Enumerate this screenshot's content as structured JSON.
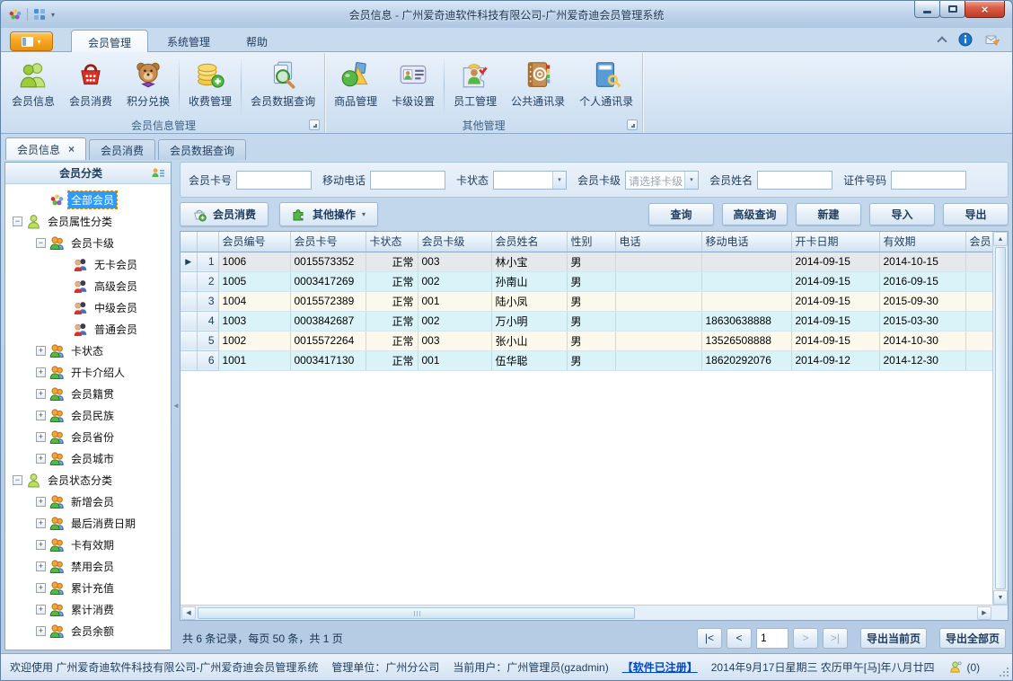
{
  "window": {
    "title": "会员信息 - 广州爱奇迪软件科技有限公司-广州爱奇迪会员管理系统"
  },
  "colors": {
    "accent_orange": "#F7A722",
    "selection_blue": "#2E9AFE",
    "row_cream": "#FCF9EC",
    "row_cyan": "#D9F3F8",
    "registered_link": "#0047CE"
  },
  "glyphs": {
    "tab_close": "×",
    "close": "×",
    "dropdown": "▾",
    "current_row": "▶",
    "splitter_left": "◄",
    "plus": "+",
    "minus": "−",
    "scroll_up": "▲",
    "scroll_down": "▼",
    "scroll_left": "◀",
    "scroll_right": "▶"
  },
  "menu": {
    "tabs": [
      {
        "label": "会员管理",
        "active": true,
        "name": "tab-member-management"
      },
      {
        "label": "系统管理",
        "active": false,
        "name": "tab-system-management"
      },
      {
        "label": "帮助",
        "active": false,
        "name": "tab-help"
      }
    ]
  },
  "ribbon": {
    "groups": [
      {
        "label": "会员信息管理",
        "buttons": [
          {
            "label": "会员信息",
            "icon": "members-icon",
            "name": "member-info"
          },
          {
            "label": "会员消费",
            "icon": "basket-icon",
            "name": "member-consume"
          },
          {
            "label": "积分兑换",
            "icon": "teddy-icon",
            "name": "points-exchange",
            "sep_after": true
          },
          {
            "label": "收费管理",
            "icon": "coins-icon",
            "name": "fee-management",
            "sep_after": true
          },
          {
            "label": "会员数据查询",
            "icon": "search-docs-icon",
            "name": "member-data-query"
          }
        ]
      },
      {
        "label": "其他管理",
        "buttons": [
          {
            "label": "商品管理",
            "icon": "goods-icon",
            "name": "goods-management"
          },
          {
            "label": "卡级设置",
            "icon": "card-icon",
            "name": "card-level-settings",
            "sep_after": true
          },
          {
            "label": "员工管理",
            "icon": "staff-icon",
            "name": "staff-management"
          },
          {
            "label": "公共通讯录",
            "icon": "public-contacts-icon",
            "name": "public-contacts"
          },
          {
            "label": "个人通讯录",
            "icon": "personal-contacts-icon",
            "name": "personal-contacts"
          }
        ]
      }
    ]
  },
  "doc_tabs": [
    {
      "label": "会员信息",
      "active": true,
      "closable": true,
      "name": "doc-tab-member-info"
    },
    {
      "label": "会员消费",
      "name": "doc-tab-member-consume"
    },
    {
      "label": "会员数据查询",
      "name": "doc-tab-member-data-query"
    }
  ],
  "sidebar": {
    "title": "会员分类",
    "tree": [
      {
        "label": "全部会员",
        "level": 1,
        "icon": "group-colorful-icon",
        "selected": true
      },
      {
        "label": "会员属性分类",
        "level": 0,
        "icon": "person-green-icon",
        "expander": "minus"
      },
      {
        "label": "会员卡级",
        "level": 1,
        "icon": "pair-orange-icon",
        "expander": "minus"
      },
      {
        "label": "无卡会员",
        "level": 2,
        "icon": "pair-red-icon"
      },
      {
        "label": "高级会员",
        "level": 2,
        "icon": "pair-red-icon"
      },
      {
        "label": "中级会员",
        "level": 2,
        "icon": "pair-red-icon"
      },
      {
        "label": "普通会员",
        "level": 2,
        "icon": "pair-red-icon"
      },
      {
        "label": "卡状态",
        "level": 1,
        "icon": "pair-orange-icon",
        "expander": "plus"
      },
      {
        "label": "开卡介绍人",
        "level": 1,
        "icon": "pair-orange-icon",
        "expander": "plus"
      },
      {
        "label": "会员籍贯",
        "level": 1,
        "icon": "pair-orange-icon",
        "expander": "plus"
      },
      {
        "label": "会员民族",
        "level": 1,
        "icon": "pair-orange-icon",
        "expander": "plus"
      },
      {
        "label": "会员省份",
        "level": 1,
        "icon": "pair-orange-icon",
        "expander": "plus"
      },
      {
        "label": "会员城市",
        "level": 1,
        "icon": "pair-orange-icon",
        "expander": "plus"
      },
      {
        "label": "会员状态分类",
        "level": 0,
        "icon": "person-green-icon",
        "expander": "minus"
      },
      {
        "label": "新增会员",
        "level": 1,
        "icon": "pair-orange-icon",
        "expander": "plus"
      },
      {
        "label": "最后消费日期",
        "level": 1,
        "icon": "pair-orange-icon",
        "expander": "plus"
      },
      {
        "label": "卡有效期",
        "level": 1,
        "icon": "pair-orange-icon",
        "expander": "plus"
      },
      {
        "label": "禁用会员",
        "level": 1,
        "icon": "pair-orange-icon",
        "expander": "plus"
      },
      {
        "label": "累计充值",
        "level": 1,
        "icon": "pair-orange-icon",
        "expander": "plus"
      },
      {
        "label": "累计消费",
        "level": 1,
        "icon": "pair-orange-icon",
        "expander": "plus"
      },
      {
        "label": "会员余额",
        "level": 1,
        "icon": "pair-orange-icon",
        "expander": "plus"
      }
    ]
  },
  "filters": [
    {
      "label": "会员卡号",
      "type": "input",
      "value": "",
      "name": "member-card-no"
    },
    {
      "label": "移动电话",
      "type": "input",
      "value": "",
      "name": "mobile-phone"
    },
    {
      "label": "卡状态",
      "type": "select",
      "value": "",
      "name": "card-status"
    },
    {
      "label": "会员卡级",
      "type": "select",
      "value": "请选择卡级",
      "muted": true,
      "name": "card-level"
    },
    {
      "label": "会员姓名",
      "type": "input",
      "value": "",
      "name": "member-name"
    },
    {
      "label": "证件号码",
      "type": "input",
      "value": "",
      "name": "id-number"
    }
  ],
  "toolbar": {
    "member_consume": {
      "label": "会员消费",
      "icon": "basket-add-icon"
    },
    "other_ops": {
      "label": "其他操作",
      "icon": "puzzle-icon"
    },
    "right_buttons": [
      {
        "label": "查询",
        "name": "query"
      },
      {
        "label": "高级查询",
        "name": "advanced-query"
      },
      {
        "label": "新建",
        "name": "new"
      },
      {
        "label": "导入",
        "name": "import"
      },
      {
        "label": "导出",
        "name": "export"
      }
    ]
  },
  "table": {
    "columns": [
      "会员编号",
      "会员卡号",
      "卡状态",
      "会员卡级",
      "会员姓名",
      "性别",
      "电话",
      "移动电话",
      "开卡日期",
      "有效期",
      "会员"
    ],
    "rows": [
      {
        "num": "1",
        "current": true,
        "cells": [
          "1006",
          "0015573352",
          "正常",
          "003",
          "林小宝",
          "男",
          "",
          "",
          "2014-09-15",
          "2014-10-15",
          ""
        ]
      },
      {
        "num": "2",
        "cells": [
          "1005",
          "0003417269",
          "正常",
          "002",
          "孙南山",
          "男",
          "",
          "",
          "2014-09-15",
          "2016-09-15",
          ""
        ]
      },
      {
        "num": "3",
        "cells": [
          "1004",
          "0015572389",
          "正常",
          "001",
          "陆小凤",
          "男",
          "",
          "",
          "2014-09-15",
          "2015-09-30",
          ""
        ]
      },
      {
        "num": "4",
        "cells": [
          "1003",
          "0003842687",
          "正常",
          "002",
          "万小明",
          "男",
          "",
          "18630638888",
          "2014-09-15",
          "2015-03-30",
          ""
        ]
      },
      {
        "num": "5",
        "cells": [
          "1002",
          "0015572264",
          "正常",
          "003",
          "张小山",
          "男",
          "",
          "13526508888",
          "2014-09-15",
          "2014-10-30",
          ""
        ]
      },
      {
        "num": "6",
        "cells": [
          "1001",
          "0003417130",
          "正常",
          "001",
          "伍华聪",
          "男",
          "",
          "18620292076",
          "2014-09-12",
          "2014-12-30",
          ""
        ]
      }
    ]
  },
  "pager": {
    "summary": "共 6 条记录，每页 50 条，共 1 页",
    "first": "|<",
    "prev": "<",
    "page": "1",
    "next": ">",
    "last": ">|",
    "export_current": "导出当前页",
    "export_all": "导出全部页"
  },
  "statusbar": {
    "welcome": "欢迎使用 广州爱奇迪软件科技有限公司-广州爱奇迪会员管理系统",
    "unit": "管理单位：广州分公司",
    "user": "当前用户：广州管理员(gzadmin)",
    "registered": "【软件已注册】",
    "date": "2014年9月17日星期三 农历甲午[马]年八月廿四",
    "online": "(0)"
  }
}
